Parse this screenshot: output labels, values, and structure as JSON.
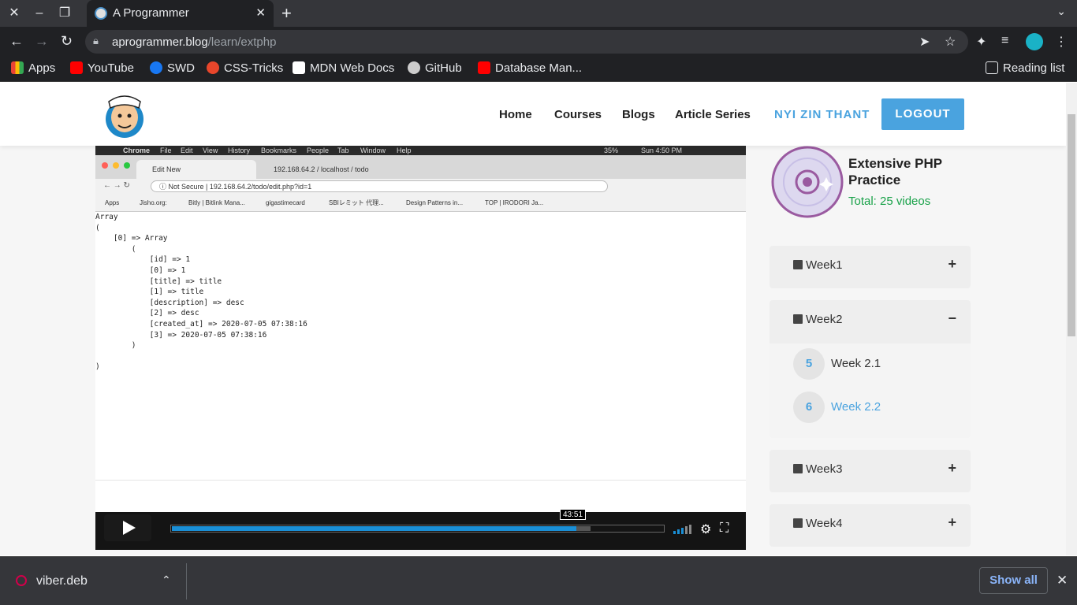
{
  "browser": {
    "tab_title": "A Programmer",
    "url_host": "aprogrammer.blog",
    "url_path": "/learn/extphp",
    "bookmarks": [
      {
        "label": "Apps"
      },
      {
        "label": "YouTube"
      },
      {
        "label": "SWD"
      },
      {
        "label": "CSS-Tricks"
      },
      {
        "label": "MDN Web Docs"
      },
      {
        "label": "GitHub"
      },
      {
        "label": "Database Man..."
      }
    ],
    "reading_list": "Reading list"
  },
  "site": {
    "nav": [
      "Home",
      "Courses",
      "Blogs",
      "Article Series"
    ],
    "user": "NYI ZIN THANT",
    "logout": "LOGOUT"
  },
  "video": {
    "mac_menu": [
      "Chrome",
      "File",
      "Edit",
      "View",
      "History",
      "Bookmarks",
      "People",
      "Tab",
      "Window",
      "Help"
    ],
    "mac_status": "Sun 4:50 PM",
    "mac_battery": "35%",
    "inner_tabs": [
      "Edit New",
      "192.168.64.2 / localhost / todo"
    ],
    "inner_url": "192.168.64.2/todo/edit.php?id=1",
    "inner_url_prefix": "Not Secure",
    "inner_bookmarks": [
      "Apps",
      "Jisho.org:",
      "Bitly | Bitlink Mana...",
      "gigastimecard",
      "SBIレミット 代理...",
      "Design Patterns in...",
      "TOP | IRODORI Ja..."
    ],
    "code": "Array\n(\n    [0] => Array\n        (\n            [id] => 1\n            [0] => 1\n            [title] => title\n            [1] => title\n            [description] => desc\n            [2] => desc\n            [created_at] => 2020-07-05 07:38:16\n            [3] => 2020-07-05 07:38:16\n        )\n\n)",
    "time_tooltip": "43:51",
    "progress_fraction": 0.82,
    "buffered_fraction": 0.85
  },
  "course": {
    "title": "Extensive PHP Practice",
    "total": "Total: 25 videos"
  },
  "weeks": [
    {
      "label": "Week1",
      "toggle": "+"
    },
    {
      "label": "Week2",
      "toggle": "−"
    },
    {
      "label": "Week3",
      "toggle": "+"
    },
    {
      "label": "Week4",
      "toggle": "+"
    }
  ],
  "lessons": [
    {
      "num": "5",
      "label": "Week 2.1"
    },
    {
      "num": "6",
      "label": "Week 2.2"
    }
  ],
  "downloads": {
    "file": "viber.deb",
    "show_all": "Show all"
  },
  "colors": {
    "accent": "#4aa3df",
    "total_green": "#1aa24a",
    "progress": "#1a8fd6"
  }
}
